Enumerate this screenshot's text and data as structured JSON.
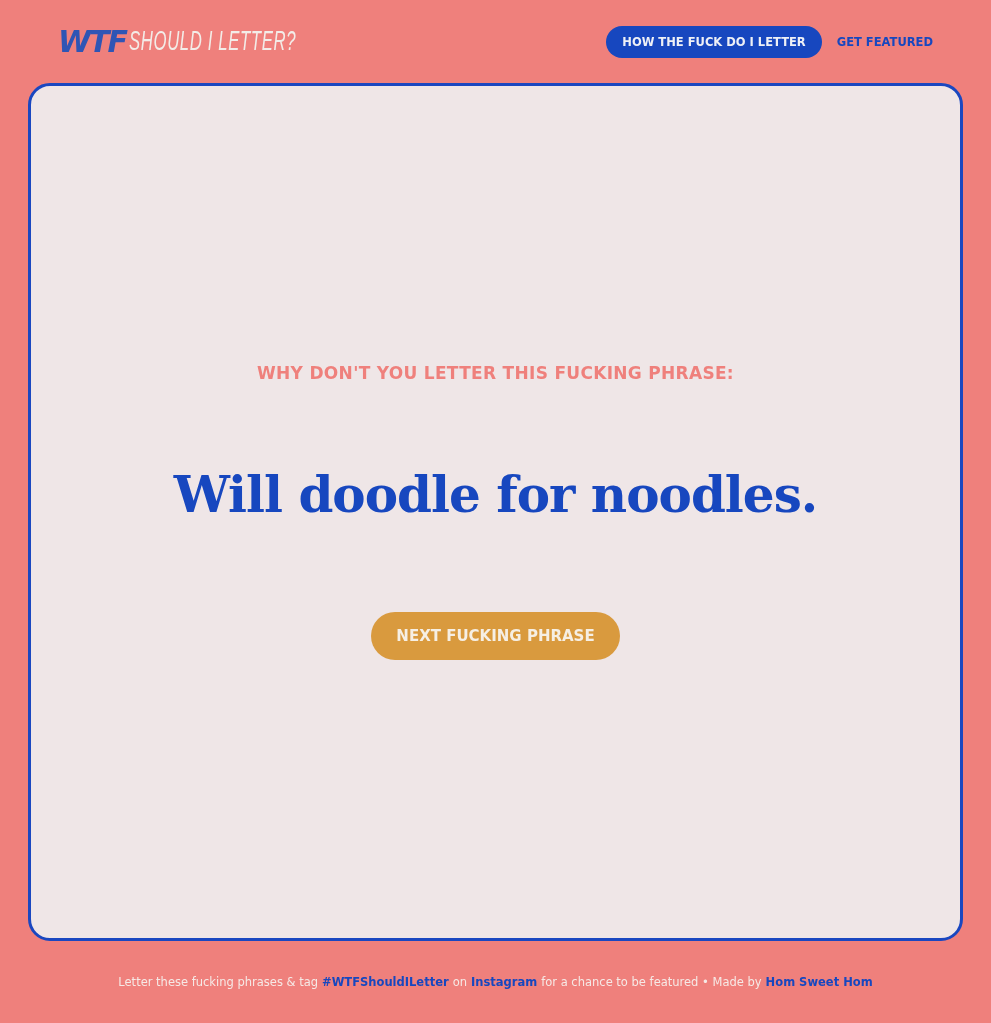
{
  "logo": {
    "mark": "WTF",
    "tagline": "SHOULD I LETTER?"
  },
  "nav": [
    {
      "label": "HOW THE FUCK DO I LETTER",
      "kind": "pill"
    },
    {
      "label": "GET FEATURED",
      "kind": "link"
    }
  ],
  "card": {
    "kicker": "WHY DON'T YOU LETTER THIS FUCKING PHRASE:",
    "phrase": "Will doodle for noodles.",
    "button": "NEXT FUCKING PHRASE"
  },
  "footer": [
    {
      "kind": "text",
      "text": "Letter these fucking phrases & tag"
    },
    {
      "kind": "link",
      "text": "#WTFShouldILetter"
    },
    {
      "kind": "text",
      "text": "on"
    },
    {
      "kind": "link",
      "text": "Instagram"
    },
    {
      "kind": "text",
      "text": "for a chance to be featured • Made by"
    },
    {
      "kind": "link",
      "text": "Hom Sweet Hom"
    }
  ]
}
